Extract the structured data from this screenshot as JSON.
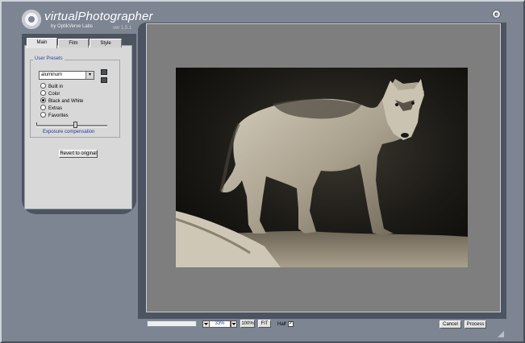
{
  "app": {
    "title": "virtualPhotographer",
    "subtitle": "by OptikVerve Labs",
    "version": "ver 1.5.1"
  },
  "icons": {
    "about": "globe-icon",
    "dropdown": "chevron-down-icon",
    "logo": "lens-logo-icon"
  },
  "tabs": [
    {
      "label": "Main",
      "active": true
    },
    {
      "label": "Film",
      "active": false
    },
    {
      "label": "Style",
      "active": false
    }
  ],
  "presets": {
    "group_title": "User Presets",
    "selected": "aluminum",
    "options": [
      {
        "label": "Built in",
        "checked": false
      },
      {
        "label": "Color",
        "checked": false
      },
      {
        "label": "Black and White",
        "checked": true
      },
      {
        "label": "Extras",
        "checked": false
      },
      {
        "label": "Favorites",
        "checked": false
      }
    ]
  },
  "exposure": {
    "label": "Exposure compensation",
    "value_fraction": 0.55
  },
  "buttons": {
    "revert": "Revert to original",
    "zoom_100": "100%",
    "fit": "FIT",
    "cancel": "Cancel",
    "process": "Process"
  },
  "zoom": {
    "value": "33%"
  },
  "half": {
    "label": "Half",
    "checked": true
  },
  "colors": {
    "background": "#7d8593",
    "panel_dark": "#4d5461",
    "panel_light": "#d8d8d8",
    "preview_bg": "#7e7e7e",
    "accent_text": "#2b44a4"
  }
}
